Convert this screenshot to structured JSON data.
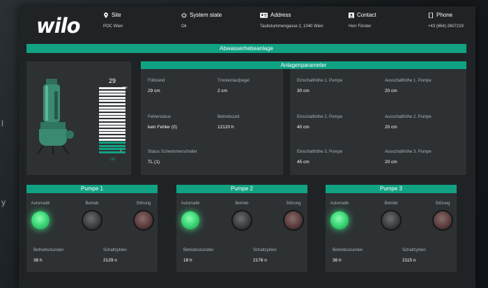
{
  "side": {
    "top": "l",
    "bottom": "y"
  },
  "header": {
    "logo": "wilo",
    "site": {
      "label": "Site",
      "value": "POC Wien"
    },
    "system_state": {
      "label": "System state",
      "value": "Ok"
    },
    "address": {
      "label": "Address",
      "value": "Taubstummengasse 2, 1040 Wien"
    },
    "contact": {
      "label": "Contact",
      "value": "Herr Förster"
    },
    "phone": {
      "label": "Phone",
      "value": "+43 (664) 2607219"
    }
  },
  "banner": "Abwasserhebeanlage",
  "level_panel": {
    "value": "29",
    "max": "150",
    "min": "7",
    "unit": "CM",
    "fill_fraction": 0.19
  },
  "parameters": {
    "title": "Anlagenparameter",
    "left": [
      {
        "label": "Füllstand",
        "value": "29 cm"
      },
      {
        "label": "Trockenlaufpegel",
        "value": "2 cm"
      },
      {
        "label": "Fehlerstatus",
        "value": "kein Fehler (0)"
      },
      {
        "label": "Betriebszeit",
        "value": "12120 h"
      },
      {
        "label": "Status Schwimmerschalter",
        "value": "TL (1)"
      }
    ],
    "right": [
      {
        "label": "Einschalthöhe 1. Pumpe",
        "value": "30 cm"
      },
      {
        "label": "Ausschalthöhe 1. Pumpe",
        "value": "20 cm"
      },
      {
        "label": "Einschalthöhe 2. Pumpe",
        "value": "40 cm"
      },
      {
        "label": "Ausschalthöhe 2. Pumpe",
        "value": "20 cm"
      },
      {
        "label": "Einschalthöhe 3. Pumpe",
        "value": "45 cm"
      },
      {
        "label": "Ausschalthöhe 3. Pumpe",
        "value": "20 cm"
      }
    ]
  },
  "pumps": [
    {
      "title": "Pumpe 1",
      "status_labels": [
        "Automatik",
        "Betrieb",
        "Störung"
      ],
      "states": [
        "on",
        "off",
        "red"
      ],
      "hours_label": "Betriebsstunden",
      "hours": "36 h",
      "cycles_label": "Schaltzyklen",
      "cycles": "2129 n"
    },
    {
      "title": "Pumpe 2",
      "status_labels": [
        "Automatik",
        "Betrieb",
        "Störung"
      ],
      "states": [
        "on",
        "off",
        "red"
      ],
      "hours_label": "Betriebsstunden",
      "hours": "18 h",
      "cycles_label": "Schaltzyklen",
      "cycles": "2176 n"
    },
    {
      "title": "Pumpe 3",
      "status_labels": [
        "Automatik",
        "Betrieb",
        "Störung"
      ],
      "states": [
        "on",
        "off",
        "red"
      ],
      "hours_label": "Betriebsstunden",
      "hours": "36 h",
      "cycles_label": "Schaltzyklen",
      "cycles": "2115 n"
    }
  ],
  "colors": {
    "accent": "#11a283",
    "panel": "#2d3134",
    "background": "#202325"
  }
}
